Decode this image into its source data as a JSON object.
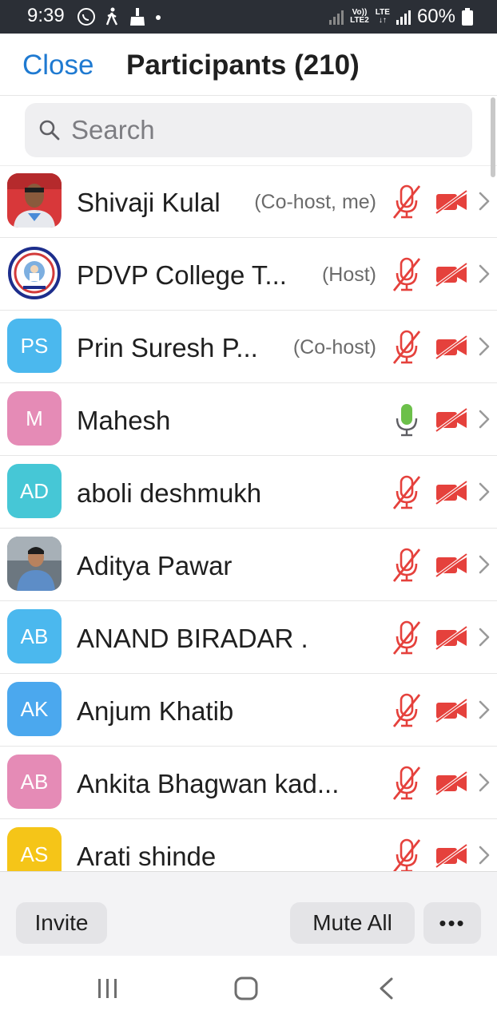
{
  "status_bar": {
    "time": "9:39",
    "network_top": "Vo))",
    "network_bottom": "LTE2",
    "lte_label": "LTE",
    "battery_percent": "60%"
  },
  "header": {
    "close_label": "Close",
    "title": "Participants (210)"
  },
  "search": {
    "placeholder": "Search"
  },
  "participants": [
    {
      "name": "Shivaji Kulal",
      "role": "(Co-host, me)",
      "avatar_type": "photo",
      "mic": "muted",
      "video": "off"
    },
    {
      "name": "PDVP College T...",
      "role": "(Host)",
      "avatar_type": "logo",
      "mic": "muted",
      "video": "off"
    },
    {
      "name": "Prin Suresh P...",
      "role": "(Co-host)",
      "avatar_type": "initials",
      "initials": "PS",
      "color": "#4bb8ee",
      "mic": "muted",
      "video": "off"
    },
    {
      "name": "Mahesh",
      "role": "",
      "avatar_type": "initials",
      "initials": "M",
      "color": "#e58bb6",
      "mic": "active",
      "video": "off"
    },
    {
      "name": "aboli deshmukh",
      "role": "",
      "avatar_type": "initials",
      "initials": "AD",
      "color": "#46c7d6",
      "mic": "muted",
      "video": "off"
    },
    {
      "name": "Aditya Pawar",
      "role": "",
      "avatar_type": "photo",
      "mic": "muted",
      "video": "off"
    },
    {
      "name": "ANAND BIRADAR .",
      "role": "",
      "avatar_type": "initials",
      "initials": "AB",
      "color": "#4bb8ee",
      "mic": "muted",
      "video": "off"
    },
    {
      "name": "Anjum Khatib",
      "role": "",
      "avatar_type": "initials",
      "initials": "AK",
      "color": "#4ba8ee",
      "mic": "muted",
      "video": "off"
    },
    {
      "name": "Ankita Bhagwan kad...",
      "role": "",
      "avatar_type": "initials",
      "initials": "AB",
      "color": "#e58bb6",
      "mic": "muted",
      "video": "off"
    },
    {
      "name": "Arati shinde",
      "role": "",
      "avatar_type": "initials",
      "initials": "AS",
      "color": "#f5c518",
      "mic": "muted",
      "video": "off"
    }
  ],
  "toolbar": {
    "invite_label": "Invite",
    "mute_all_label": "Mute All",
    "more_label": "•••"
  },
  "colors": {
    "accent": "#1f7ad1",
    "muted_red": "#e5413c",
    "active_mic_green": "#6cc04a"
  },
  "icons": [
    "search-icon",
    "mic-muted-icon",
    "mic-active-icon",
    "video-off-icon",
    "chevron-right-icon",
    "recent-apps-icon",
    "home-icon",
    "back-icon"
  ]
}
